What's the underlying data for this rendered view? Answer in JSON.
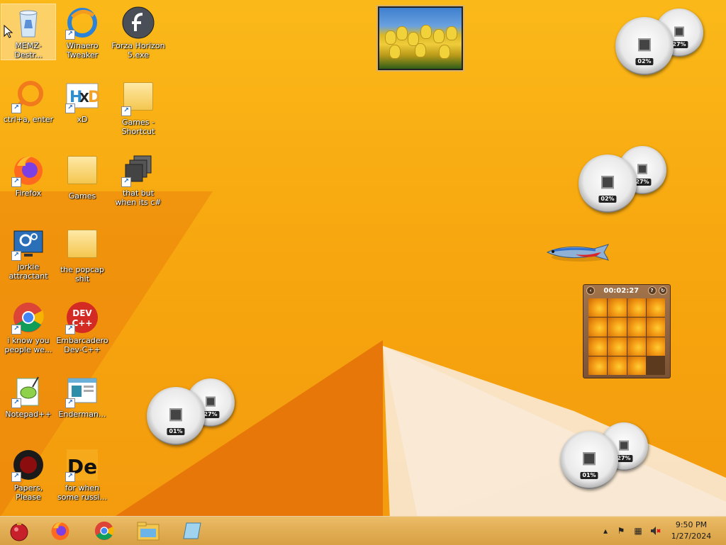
{
  "desktop": {
    "icons": [
      {
        "label": "MEMZ-Destr...",
        "selected": true
      },
      {
        "label": "Winaero Tweaker"
      },
      {
        "label": "Forza Horizon 5.exe"
      },
      {
        "label": "ctrl+a, enter"
      },
      {
        "label": "xD"
      },
      {
        "label": "Games - Shortcut"
      },
      {
        "label": "Firefox"
      },
      {
        "label": "Games"
      },
      {
        "label": "that but when its c#"
      },
      {
        "label": "jorkie attractant"
      },
      {
        "label": "the popcap shit"
      },
      {
        "label": "i know you people we..."
      },
      {
        "label": "Embarcadero Dev-C++"
      },
      {
        "label": "Notepad++"
      },
      {
        "label": "Enderman..."
      },
      {
        "label": "Papers, Please"
      },
      {
        "label": "for when some russi..."
      }
    ]
  },
  "gadgets": {
    "meters": [
      {
        "cpu": "02%",
        "ram": "27%"
      },
      {
        "cpu": "02%",
        "ram": "27%"
      },
      {
        "cpu": "01%",
        "ram": "27%"
      },
      {
        "cpu": "01%",
        "ram": "27%"
      }
    ],
    "puzzle": {
      "timer": "00:02:27"
    }
  },
  "taskbar": {
    "pinned": [
      "start-orb",
      "firefox",
      "chrome",
      "file-explorer",
      "notepad"
    ],
    "clock": {
      "time": "9:50 PM",
      "date": "1/27/2024"
    },
    "tray_icons": [
      "show-hidden-icons",
      "action-center-flag",
      "network-icon",
      "volume-muted-icon"
    ]
  },
  "colors": {
    "wallpaper": "#fbb919",
    "taskbar": "#dcae60",
    "meter_arc": "#e45d4b"
  }
}
